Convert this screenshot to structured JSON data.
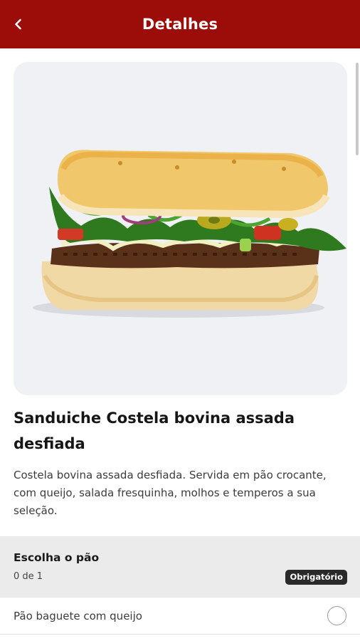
{
  "appbar": {
    "title": "Detalhes",
    "back_icon": "chevron-left-icon",
    "background_color": "#9c0c08"
  },
  "product": {
    "image": "sandwich-photo",
    "title": "Sanduiche Costela bovina assada desfiada",
    "description": "Costela bovina assada desfiada. Servida em pão crocante, com queijo, salada fresquinha, molhos e temperos a sua seleção."
  },
  "options_section": {
    "title": "Escolha o pão",
    "count": "0 de 1",
    "badge": "Obrigatório",
    "items": [
      {
        "label": "Pão baguete com queijo",
        "selected": false
      }
    ]
  }
}
